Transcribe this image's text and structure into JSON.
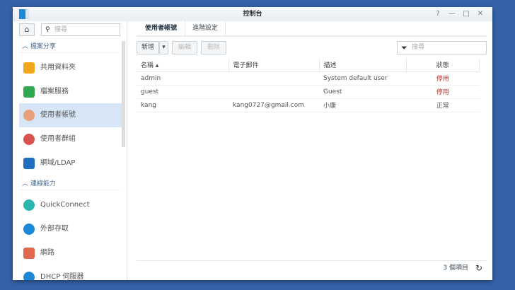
{
  "window": {
    "title": "控制台",
    "controls": [
      "?",
      "—",
      "□",
      "✕"
    ]
  },
  "sidebar": {
    "search_placeholder": "搜尋",
    "sections": [
      {
        "label": "檔案分享"
      },
      {
        "label": "連線能力"
      }
    ],
    "items": [
      {
        "label": "共用資料夾",
        "color": "#f2a81d"
      },
      {
        "label": "檔案服務",
        "color": "#2fa84f"
      },
      {
        "label": "使用者帳號",
        "color": "#e6a07a"
      },
      {
        "label": "使用者群組",
        "color": "#d9534f"
      },
      {
        "label": "網域/LDAP",
        "color": "#1e6fc0"
      },
      {
        "label": "QuickConnect",
        "color": "#2bb5b0"
      },
      {
        "label": "外部存取",
        "color": "#1e88d8"
      },
      {
        "label": "網路",
        "color": "#e0684f"
      },
      {
        "label": "DHCP 伺服器",
        "color": "#1e88d8"
      }
    ]
  },
  "tabs": [
    {
      "label": "使用者帳號"
    },
    {
      "label": "進階設定"
    }
  ],
  "toolbar": {
    "add": "新增",
    "edit": "編輯",
    "delete": "刪除",
    "filter_placeholder": "搜尋"
  },
  "table": {
    "headers": [
      "名稱 ▴",
      "電子郵件",
      "描述",
      "狀態"
    ],
    "rows": [
      [
        "admin",
        "",
        "System default user",
        "停用"
      ],
      [
        "guest",
        "",
        "Guest",
        "停用"
      ],
      [
        "kang",
        "kang0727@gmail.com",
        "小康",
        "正常"
      ]
    ]
  },
  "status": {
    "count": "3 個項目"
  }
}
